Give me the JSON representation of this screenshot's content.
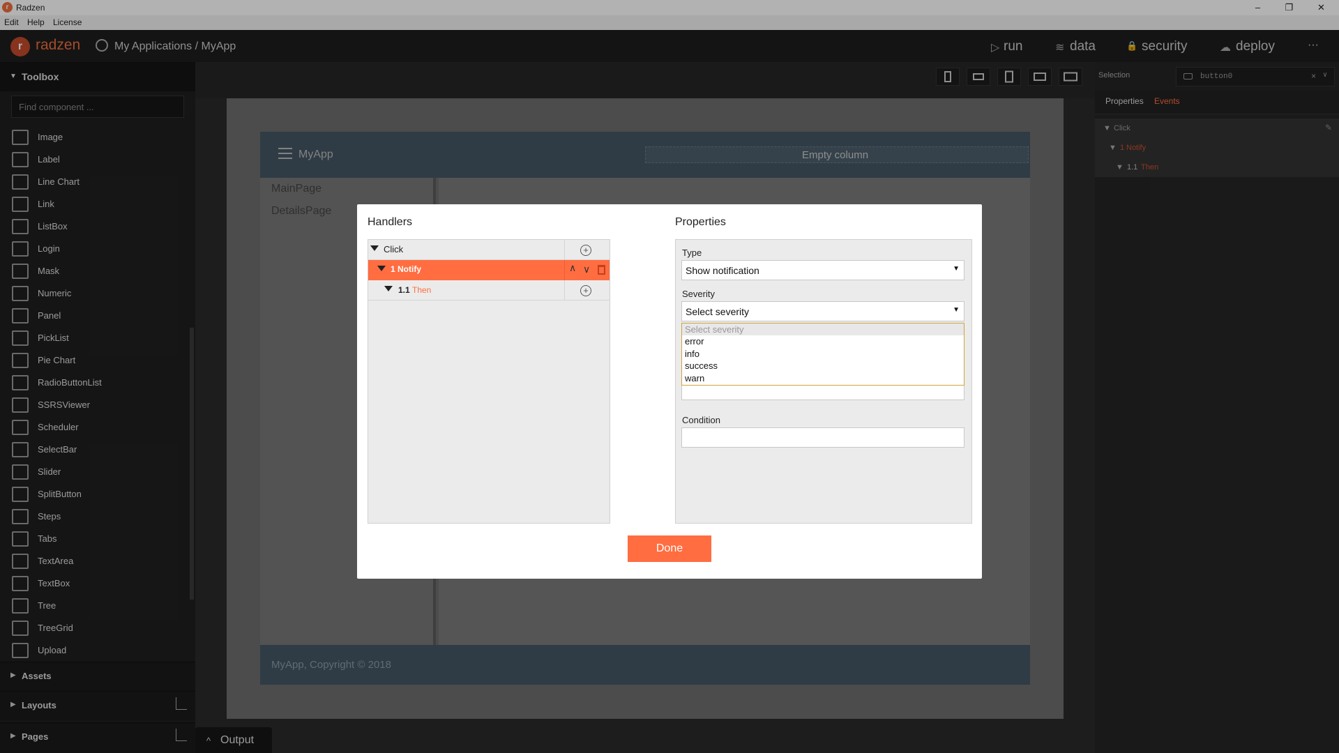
{
  "window": {
    "title": "Radzen",
    "minimize": "–",
    "maximize": "❐",
    "close": "✕"
  },
  "menu": [
    "Edit",
    "Help",
    "License"
  ],
  "topnav": {
    "brand": "radzen",
    "breadcrumb": "My Applications / MyApp",
    "items": [
      {
        "label": "run",
        "icon": "play-icon",
        "glyph": "▷"
      },
      {
        "label": "data",
        "icon": "layers-icon",
        "glyph": "≋"
      },
      {
        "label": "security",
        "icon": "lock-icon",
        "glyph": "🔒"
      },
      {
        "label": "deploy",
        "icon": "cloud-upload-icon",
        "glyph": "☁"
      }
    ],
    "more": "···"
  },
  "toolbox": {
    "title": "Toolbox",
    "search_placeholder": "Find component ...",
    "items": [
      "Image",
      "Label",
      "Line Chart",
      "Link",
      "ListBox",
      "Login",
      "Mask",
      "Numeric",
      "Panel",
      "PickList",
      "Pie Chart",
      "RadioButtonList",
      "SSRSViewer",
      "Scheduler",
      "SelectBar",
      "Slider",
      "SplitButton",
      "Steps",
      "Tabs",
      "TextArea",
      "TextBox",
      "Tree",
      "TreeGrid",
      "Upload"
    ],
    "sections": [
      "Assets",
      "Layouts",
      "Pages"
    ]
  },
  "canvas": {
    "app_title": "MyApp",
    "empty_column": "Empty column",
    "pages": [
      "MainPage",
      "DetailsPage"
    ],
    "footer": "MyApp, Copyright © 2018"
  },
  "output": {
    "label": "Output",
    "glyph": "^"
  },
  "right_panel": {
    "selection_label": "Selection",
    "selection_value": "button0",
    "clear": "×",
    "tabs": [
      "Properties",
      "Events"
    ],
    "events": {
      "event": "Click",
      "action_num": "1",
      "action": "Notify",
      "then_num": "1.1",
      "then": "Then"
    }
  },
  "dialog": {
    "handlers_title": "Handlers",
    "properties_title": "Properties",
    "handlers": {
      "event": "Click",
      "action_num": "1",
      "action": "Notify",
      "then_num": "1.1",
      "then": "Then"
    },
    "type_label": "Type",
    "type_value": "Show notification",
    "severity_label": "Severity",
    "severity_value": "Select severity",
    "severity_options": [
      "Select severity",
      "error",
      "info",
      "success",
      "warn"
    ],
    "condition_label": "Condition",
    "condition_value": "",
    "done_label": "Done"
  },
  "colors": {
    "accent": "#ff6d41",
    "brand": "#ee6e3e",
    "header": "#445663"
  }
}
